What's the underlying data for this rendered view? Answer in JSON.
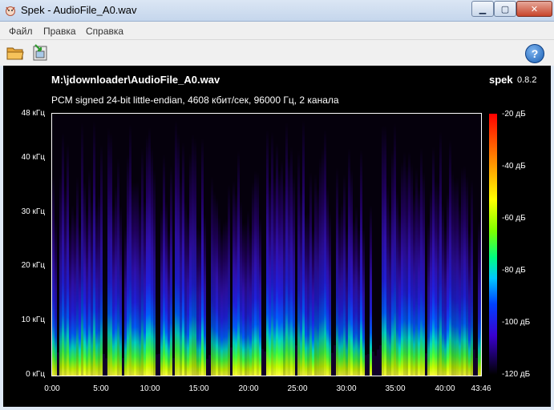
{
  "window": {
    "title": "Spek - AudioFile_A0.wav",
    "min_symbol": "▁",
    "max_symbol": "▢",
    "close_symbol": "✕"
  },
  "menu": {
    "items": [
      {
        "label": "Файл"
      },
      {
        "label": "Правка"
      },
      {
        "label": "Справка"
      }
    ]
  },
  "toolbar": {
    "open_icon": "folder-open-icon",
    "save_icon": "save-image-icon",
    "help_icon": "help-icon",
    "help_symbol": "?"
  },
  "spectrogram": {
    "file_path": "M:\\jdownloader\\AudioFile_A0.wav",
    "app_name": "spek",
    "app_version": "0.8.2",
    "stream_info": "PCM signed 24-bit little-endian, 4608 кбит/сек, 96000 Гц, 2 канала",
    "y_ticks": [
      "48 кГц",
      "40 кГц",
      "30 кГц",
      "20 кГц",
      "10 кГц",
      "0 кГц"
    ],
    "x_ticks": [
      "0:00",
      "5:00",
      "10:00",
      "15:00",
      "20:00",
      "25:00",
      "30:00",
      "35:00",
      "40:00",
      "43:46"
    ],
    "colorbar_ticks": [
      "-20 дБ",
      "-40 дБ",
      "-60 дБ",
      "-80 дБ",
      "-100 дБ",
      "-120 дБ"
    ],
    "colors": {
      "loud": "#ff0000",
      "mid": "#ffff00",
      "quiet": "#3a00d0",
      "silence": "#000000"
    }
  }
}
